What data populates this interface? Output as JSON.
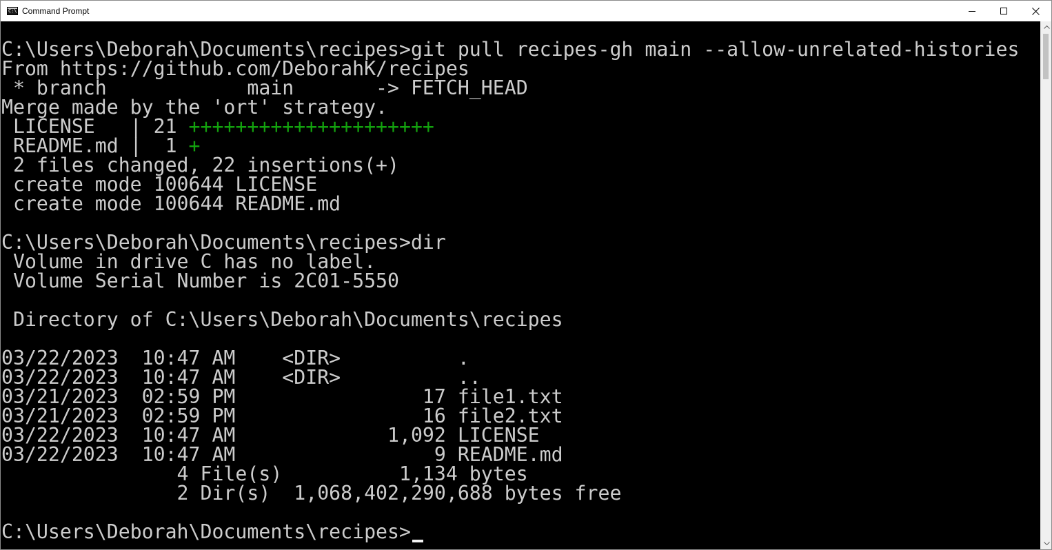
{
  "window": {
    "title": "Command Prompt",
    "app_icon_text": "C:\\",
    "icon": "cmd-icon"
  },
  "controls": {
    "minimize_icon": "minimize-icon",
    "maximize_icon": "maximize-icon",
    "close_icon": "close-icon"
  },
  "console": {
    "lines": [
      "C:\\Users\\Deborah\\Documents\\recipes>git pull recipes-gh main --allow-unrelated-histories",
      "From https://github.com/DeborahK/recipes",
      " * branch            main       -> FETCH_HEAD",
      "Merge made by the 'ort' strategy.",
      " LICENSE   | 21 ",
      " README.md |  1 ",
      " 2 files changed, 22 insertions(+)",
      " create mode 100644 LICENSE",
      " create mode 100644 README.md",
      "",
      "C:\\Users\\Deborah\\Documents\\recipes>dir",
      " Volume in drive C has no label.",
      " Volume Serial Number is 2C01-5550",
      "",
      " Directory of C:\\Users\\Deborah\\Documents\\recipes",
      "",
      "03/22/2023  10:47 AM    <DIR>          .",
      "03/22/2023  10:47 AM    <DIR>          ..",
      "03/21/2023  02:59 PM                17 file1.txt",
      "03/21/2023  02:59 PM                16 file2.txt",
      "03/22/2023  10:47 AM             1,092 LICENSE",
      "03/22/2023  10:47 AM                 9 README.md",
      "               4 File(s)          1,134 bytes",
      "               2 Dir(s)  1,068,402,290,688 bytes free",
      "",
      "C:\\Users\\Deborah\\Documents\\recipes>"
    ],
    "license_additions": "+++++++++++++++++++++",
    "readme_additions": "+",
    "cursor_icon": "cursor-icon"
  },
  "colors": {
    "background": "#000000",
    "text": "#cccccc",
    "additions": "#13a10e",
    "titlebar": "#ffffff"
  },
  "scrollbar": {
    "up_icon": "scroll-up-icon",
    "down_icon": "scroll-down-icon"
  }
}
